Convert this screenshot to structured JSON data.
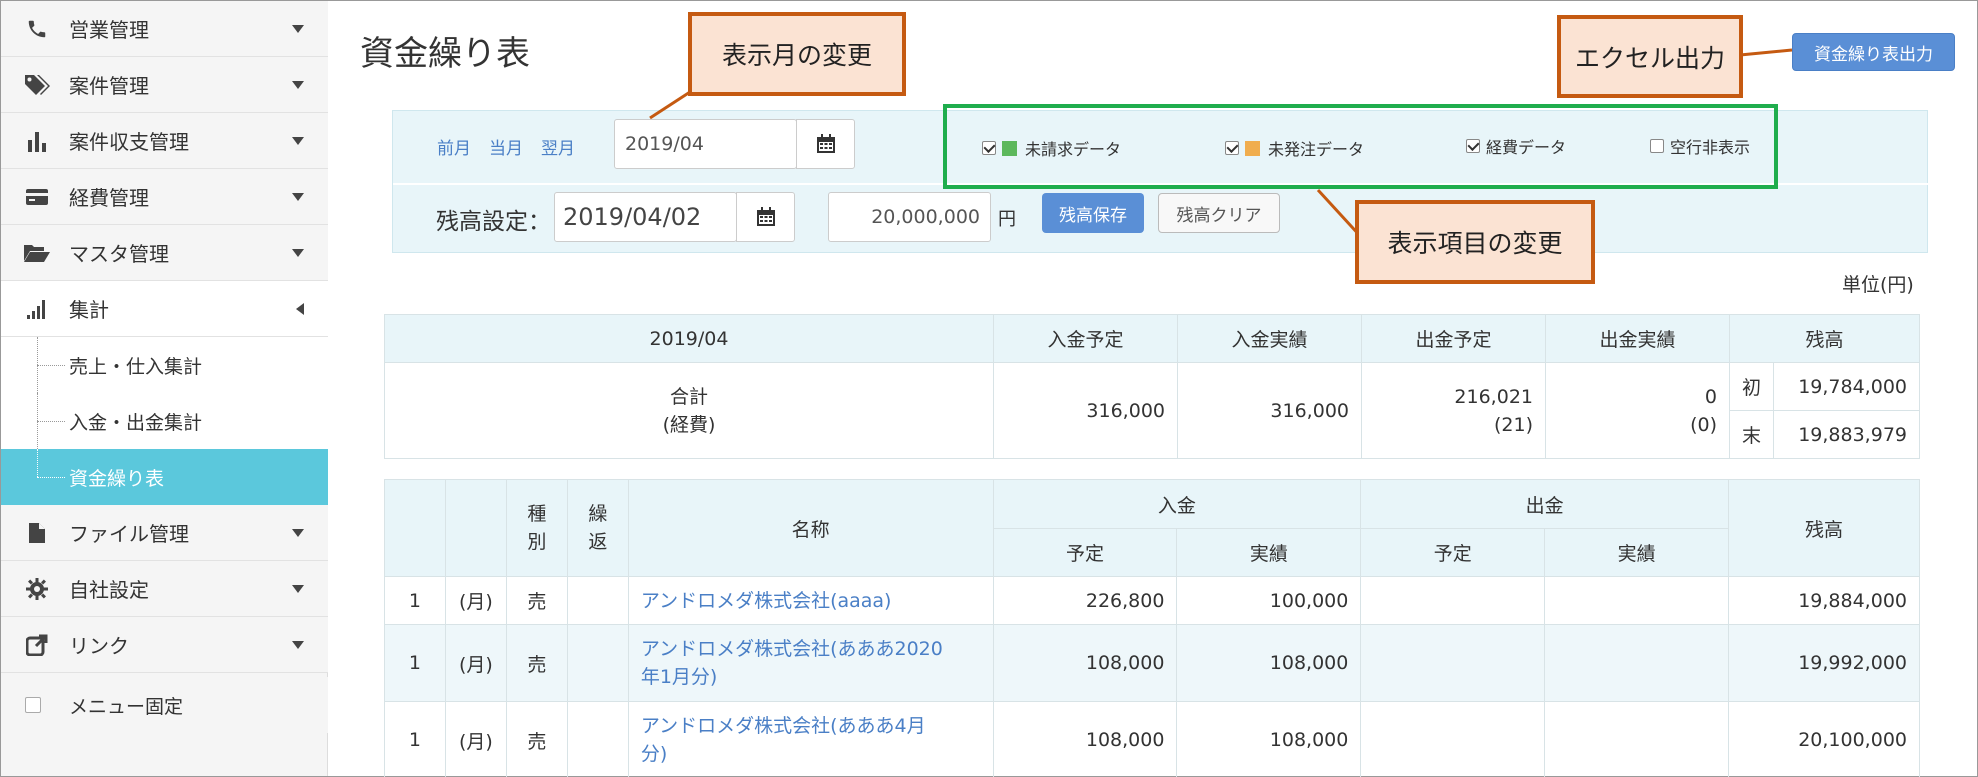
{
  "sidebar": {
    "items": [
      {
        "label": "営業管理",
        "icon": "phone-icon"
      },
      {
        "label": "案件管理",
        "icon": "tags-icon"
      },
      {
        "label": "案件収支管理",
        "icon": "bar-chart-icon"
      },
      {
        "label": "経費管理",
        "icon": "credit-card-icon"
      },
      {
        "label": "マスタ管理",
        "icon": "folder-open-icon"
      },
      {
        "label": "集計",
        "icon": "signal-icon"
      }
    ],
    "sub_items": [
      {
        "label": "売上・仕入集計"
      },
      {
        "label": "入金・出金集計"
      },
      {
        "label": "資金繰り表"
      }
    ],
    "items_bottom": [
      {
        "label": "ファイル管理",
        "icon": "file-icon"
      },
      {
        "label": "自社設定",
        "icon": "gear-icon"
      },
      {
        "label": "リンク",
        "icon": "external-link-icon"
      }
    ],
    "menu_fix_label": "メニュー固定"
  },
  "header": {
    "title": "資金繰り表",
    "excel_button": "資金繰り表出力"
  },
  "filters": {
    "prev_month": "前月",
    "this_month": "当月",
    "next_month": "翌月",
    "month_value": "2019/04",
    "checkboxes": [
      {
        "label": "未請求データ",
        "checked": true,
        "color": "#5cb85c"
      },
      {
        "label": "未発注データ",
        "checked": true,
        "color": "#f0ad4e"
      },
      {
        "label": "経費データ",
        "checked": true
      },
      {
        "label": "空行非表示",
        "checked": false
      }
    ],
    "balance_label": "残高設定：",
    "balance_date": "2019/04/02",
    "balance_amount": "20,000,000",
    "yen": "円",
    "save_button": "残高保存",
    "clear_button": "残高クリア",
    "unit_label": "単位(円)"
  },
  "summary": {
    "headers": [
      "2019/04",
      "入金予定",
      "入金実績",
      "出金予定",
      "出金実績",
      "残高"
    ],
    "total_label": "合計",
    "expense_label": "(経費)",
    "in_plan": "316,000",
    "in_actual": "316,000",
    "out_plan": "216,021",
    "out_plan_expense": "(21)",
    "out_actual": "0",
    "out_actual_expense": "(0)",
    "start_label": "初",
    "start_balance": "19,784,000",
    "end_label": "末",
    "end_balance": "19,883,979"
  },
  "detail": {
    "headers": {
      "type_top": "種",
      "type_bottom": "別",
      "repeat_top": "繰",
      "repeat_bottom": "返",
      "name": "名称",
      "income": "入金",
      "expense": "出金",
      "plan": "予定",
      "actual": "実績",
      "balance": "残高"
    },
    "rows": [
      {
        "day": "1",
        "weekday": "(月)",
        "type": "売",
        "name": "アンドロメダ株式会社(aaaa)",
        "in_plan": "226,800",
        "in_actual": "100,000",
        "balance": "19,884,000"
      },
      {
        "day": "1",
        "weekday": "(月)",
        "type": "売",
        "name_line1": "アンドロメダ株式会社(あああ2020",
        "name_line2": "年1月分)",
        "in_plan": "108,000",
        "in_actual": "108,000",
        "balance": "19,992,000"
      },
      {
        "day": "1",
        "weekday": "(月)",
        "type": "売",
        "name_line1": "アンドロメダ株式会社(あああ4月",
        "name_line2": "分)",
        "in_plan": "108,000",
        "in_actual": "108,000",
        "balance": "20,100,000"
      }
    ]
  },
  "callouts": {
    "month_change": "表示月の変更",
    "excel_output": "エクセル出力",
    "display_items": "表示項目の変更"
  },
  "colors": {
    "accent": "#5a8fd6",
    "active_menu": "#5bc8dc",
    "callout_border": "#c55a11",
    "callout_fill": "#fbe3d3",
    "highlight_green": "#1fad4d"
  }
}
